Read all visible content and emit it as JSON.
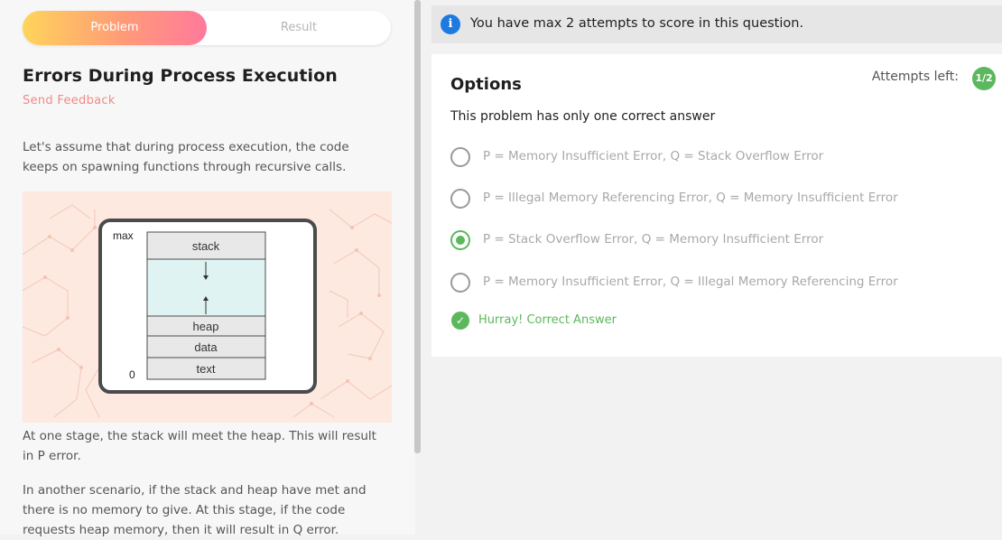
{
  "tabs": {
    "problem": "Problem",
    "result": "Result"
  },
  "problem": {
    "title": "Errors During Process Execution",
    "feedback": "Send Feedback",
    "intro": "Let's assume that during process execution, the code keeps on spawning functions through recursive calls.",
    "stage1": "At one stage, the stack will meet the heap. This will result in P error.",
    "stage2": "In another scenario, if the stack and heap have met and there is no memory to give. At this stage, if the code requests heap memory, then it will result in Q error."
  },
  "diagram": {
    "max_label": "max",
    "zero_label": "0",
    "segments": [
      "stack",
      "heap",
      "data",
      "text"
    ]
  },
  "banner": {
    "icon": "info-icon",
    "text": "You have max 2 attempts to score in this question."
  },
  "options": {
    "heading": "Options",
    "attempts_label": "Attempts left:",
    "attempts_value": "1/2",
    "hint": "This problem has only one correct answer",
    "items": [
      {
        "label": "P = Memory Insufficient Error, Q = Stack Overflow Error",
        "selected": false
      },
      {
        "label": "P = Illegal Memory Referencing Error, Q = Memory Insufficient Error",
        "selected": false
      },
      {
        "label": "P = Stack Overflow Error, Q = Memory Insufficient Error",
        "selected": true
      },
      {
        "label": "P = Memory Insufficient Error, Q = Illegal Memory Referencing Error",
        "selected": false
      }
    ],
    "result_text": "Hurray! Correct Answer"
  },
  "colors": {
    "accent_green": "#5cb85c",
    "info_blue": "#1f7ae0",
    "feedback_pink": "#f08a8a",
    "diagram_bg": "#fde9e0",
    "free_space": "#dff3f3"
  }
}
